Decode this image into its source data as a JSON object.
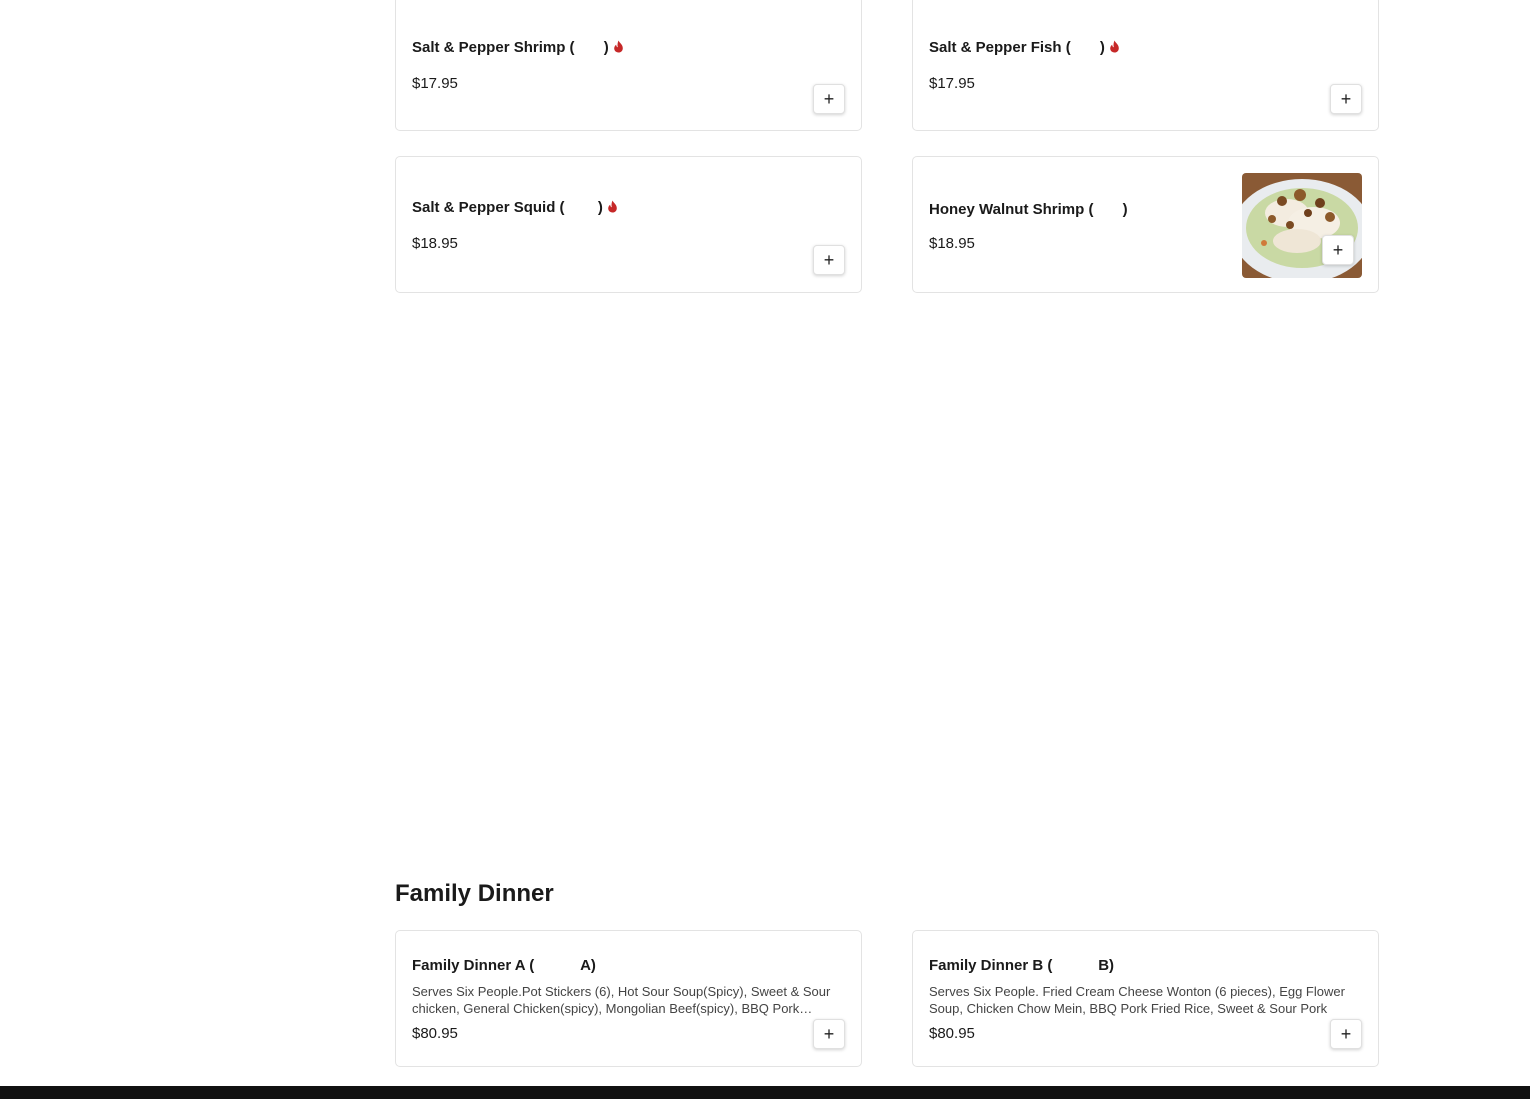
{
  "items": [
    {
      "name": "Salt & Pepper Shrimp (       )",
      "price": "$17.95",
      "spicy": true
    },
    {
      "name": "Salt & Pepper Fish (       )",
      "price": "$17.95",
      "spicy": true
    },
    {
      "name": "Salt & Pepper Squid (        )",
      "price": "$18.95",
      "spicy": true
    },
    {
      "name": "Honey Walnut Shrimp (       )",
      "price": "$18.95",
      "spicy": false,
      "image": "honey-walnut-shrimp-photo"
    }
  ],
  "family_dinner": {
    "title": "Family Dinner",
    "items": [
      {
        "name": "Family Dinner A (           A)",
        "description": "Serves Six People.Pot Stickers (6), Hot Sour Soup(Spicy), Sweet & Sour chicken, General Chicken(spicy), Mongolian Beef(spicy), BBQ Pork Fried Rice",
        "price": "$80.95"
      },
      {
        "name": "Family Dinner B (           B)",
        "description": "Serves Six People. Fried Cream Cheese Wonton (6 pieces), Egg Flower Soup, Chicken Chow Mein, BBQ Pork Fried Rice, Sweet & Sour Pork",
        "price": "$80.95"
      }
    ]
  },
  "add_label": "+",
  "colors": {
    "spicy": "#c62828",
    "border": "#e3e3e3",
    "footer": "#111111"
  }
}
